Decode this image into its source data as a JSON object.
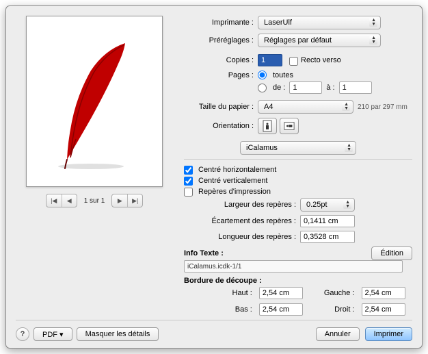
{
  "labels": {
    "printer": "Imprimante :",
    "presets": "Préréglages :",
    "copies": "Copies :",
    "recto_verso": "Recto verso",
    "pages": "Pages :",
    "all": "toutes",
    "from": "de :",
    "to": "à :",
    "paper_size": "Taille du papier :",
    "orientation": "Orientation :",
    "center_h": "Centré horizontalement",
    "center_v": "Centré verticalement",
    "print_marks": "Repères d'impression",
    "mark_width": "Largeur des repères :",
    "mark_gap": "Écartement des repères :",
    "mark_length": "Longueur des repères :",
    "info_text": "Info Texte :",
    "edit": "Édition",
    "bleed": "Bordure de découpe :",
    "top": "Haut :",
    "left": "Gauche :",
    "bottom": "Bas :",
    "right": "Droit :",
    "pdf": "PDF",
    "hide_details": "Masquer les détails",
    "cancel": "Annuler",
    "print": "Imprimer"
  },
  "values": {
    "printer": "LaserUlf",
    "preset": "Réglages par défaut",
    "copies": "1",
    "page_from": "1",
    "page_to": "1",
    "paper": "A4",
    "paper_dim": "210 par 297 mm",
    "app_name": "iCalamus",
    "mark_width": "0.25pt",
    "mark_gap": "0,1411 cm",
    "mark_length": "0,3528 cm",
    "info_text": "iCalamus.icdk-1/1",
    "bleed_top": "2,54 cm",
    "bleed_left": "2,54 cm",
    "bleed_bottom": "2,54 cm",
    "bleed_right": "2,54 cm",
    "pager": "1 sur 1"
  },
  "state": {
    "recto_verso": false,
    "pages_all": true,
    "center_h": true,
    "center_v": true,
    "print_marks": false
  }
}
